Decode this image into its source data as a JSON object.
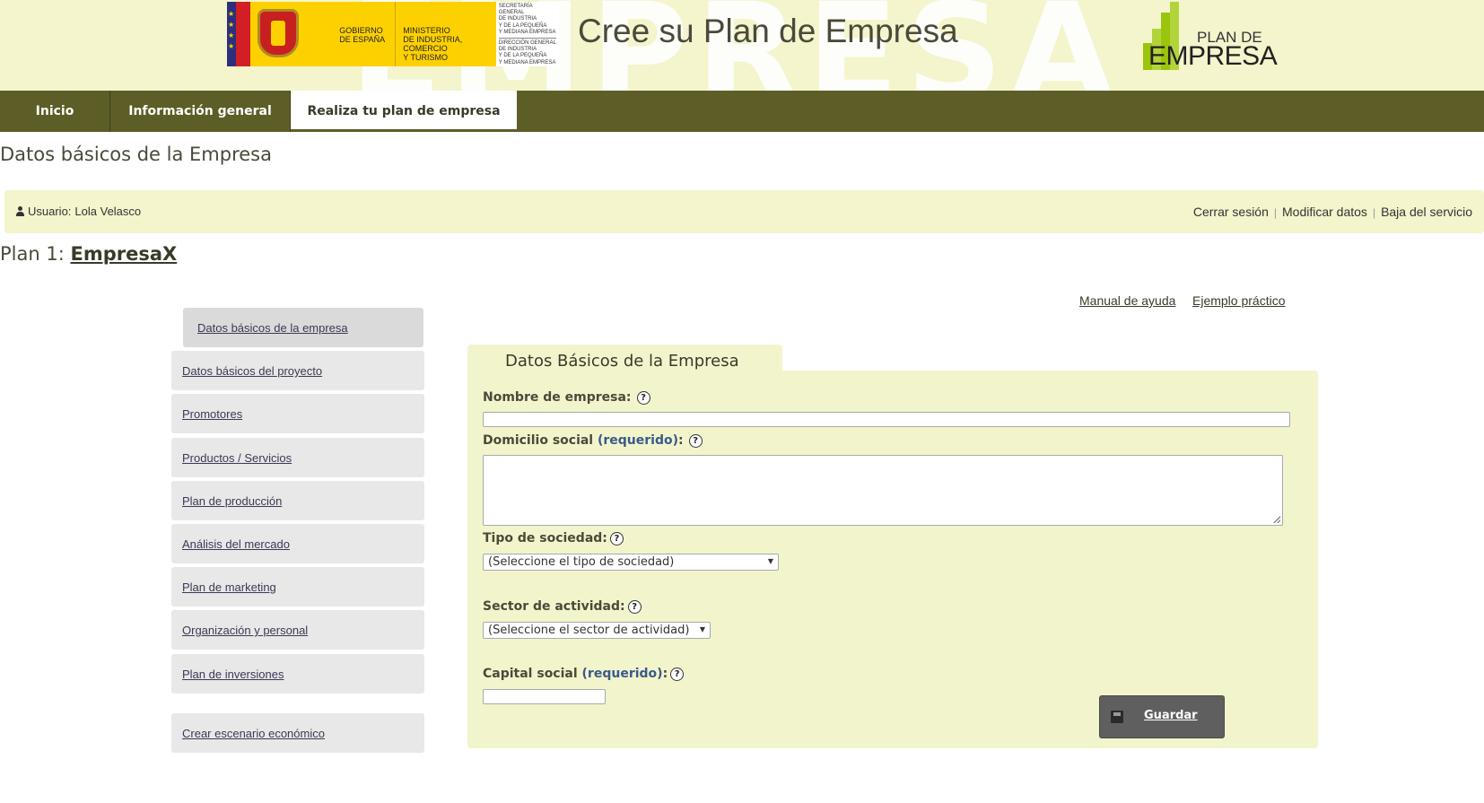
{
  "header": {
    "watermark": "EMPRESA",
    "gov_logo": {
      "text1": [
        "GOBIERNO",
        "DE ESPAÑA"
      ],
      "text2": [
        "MINISTERIO",
        "DE INDUSTRIA, COMERCIO",
        "Y TURISMO"
      ],
      "secretaria": [
        "SECRETARÍA GENERAL",
        "DE INDUSTRIA",
        "Y DE LA PEQUEÑA",
        "Y MEDIANA EMPRESA"
      ],
      "direccion": [
        "DIRECCIÓN GENERAL",
        "DE INDUSTRIA",
        "Y DE LA PEQUEÑA",
        "Y MEDIANA EMPRESA"
      ]
    },
    "site_title": "Cree su Plan de Empresa",
    "plan_logo": {
      "line1": "PLAN DE",
      "line2": "EMPRESA",
      "bar_color": "#9bc40c"
    }
  },
  "nav": {
    "items": [
      {
        "label": "Inicio",
        "active": false
      },
      {
        "label": "Información general",
        "active": false
      },
      {
        "label": "Realiza tu plan de empresa",
        "active": true
      }
    ]
  },
  "page_heading": "Datos básicos de la Empresa",
  "userbar": {
    "user_prefix": "Usuario:",
    "user_name": "Lola Velasco",
    "links": [
      "Cerrar sesión",
      "Modificar datos",
      "Baja del servicio"
    ]
  },
  "plan": {
    "prefix": "Plan 1:",
    "name": "EmpresaX"
  },
  "help_links": {
    "manual": "Manual de ayuda",
    "ejemplo": "Ejemplo práctico"
  },
  "sidebar": {
    "items": [
      {
        "label": "Datos básicos de la empresa",
        "active": true
      },
      {
        "label": "Datos básicos del proyecto",
        "active": false
      },
      {
        "label": "Promotores",
        "active": false
      },
      {
        "label": "Productos / Servicios",
        "active": false
      },
      {
        "label": "Plan de producción",
        "active": false
      },
      {
        "label": "Análisis del mercado",
        "active": false
      },
      {
        "label": "Plan de marketing",
        "active": false
      },
      {
        "label": "Organización y personal",
        "active": false
      },
      {
        "label": "Plan de inversiones",
        "active": false
      }
    ],
    "extra": "Crear escenario económico"
  },
  "form": {
    "tab_title": "Datos Básicos de la Empresa",
    "help_glyph": "?",
    "nombre": {
      "label": "Nombre de empresa:",
      "value": ""
    },
    "domicilio": {
      "label": "Domicilio social",
      "req": "(requerido)",
      "colon": ":",
      "value": ""
    },
    "tipo": {
      "label": "Tipo de sociedad:",
      "selected": "(Seleccione el tipo de sociedad)"
    },
    "sector": {
      "label": "Sector de actividad:",
      "selected": "(Seleccione el sector de actividad)"
    },
    "capital": {
      "label": "Capital social",
      "req": "(requerido)",
      "colon": ":",
      "value": ""
    },
    "save_label": "Guardar"
  },
  "colors": {
    "banner_bg": "#f4f4cd",
    "nav_bg": "#5d5e27",
    "panel_bg": "#f2f5cc",
    "sidebar_bg": "#e8e8e8",
    "save_bg": "#5f5f5f",
    "required_text": "#3a5a8a"
  }
}
